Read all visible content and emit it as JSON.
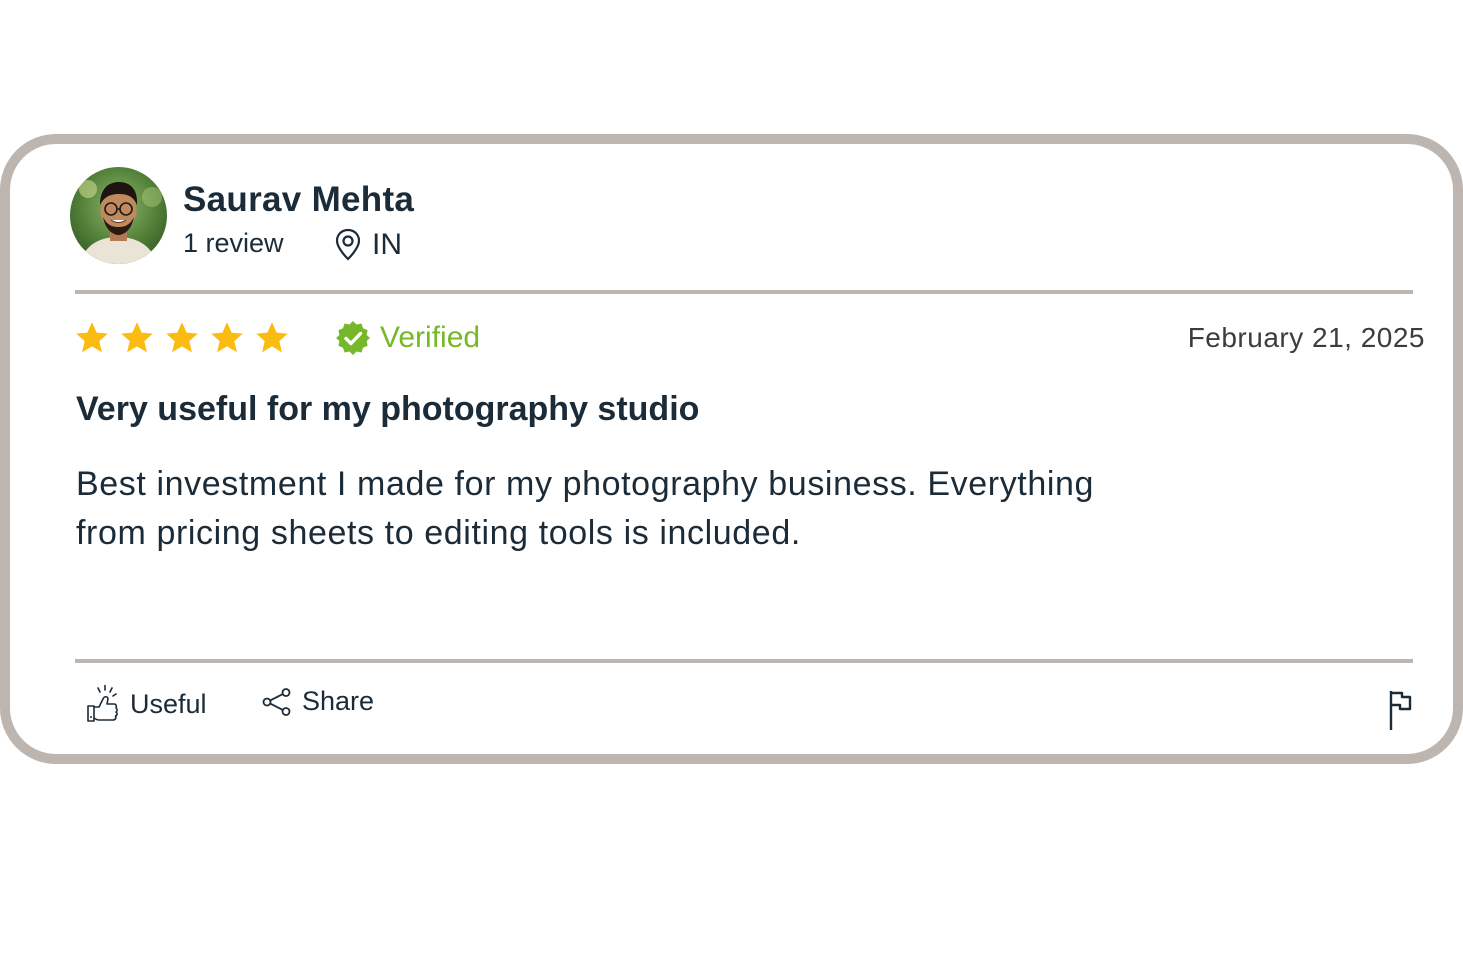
{
  "reviewer": {
    "name": "Saurav Mehta",
    "review_count": "1 review",
    "location": "IN",
    "avatar_icon": "user-avatar"
  },
  "review": {
    "rating": 5,
    "rating_max": 5,
    "verified_label": "Verified",
    "date": "February 21, 2025",
    "title": "Very useful for my photography studio",
    "body": "Best investment I made for my photography business. Everything from pricing sheets to editing tools is included."
  },
  "actions": {
    "useful_label": "Useful",
    "share_label": "Share",
    "flag_icon": "flag-icon"
  },
  "colors": {
    "star": "#fbbc11",
    "verified": "#76b82a",
    "border": "#bdb6b0",
    "text": "#1b2b38"
  }
}
